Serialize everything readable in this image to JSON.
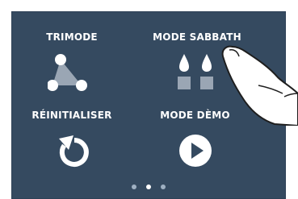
{
  "tiles": [
    {
      "label": "TRIMODE",
      "icon": "trimode-triangle-icon"
    },
    {
      "label": "MODE SABBATH",
      "icon": "sabbath-candles-icon"
    },
    {
      "label": "RÉINITIALISER",
      "icon": "reset-arrow-icon"
    },
    {
      "label": "MODE DÈMO",
      "icon": "play-icon"
    }
  ],
  "pagination": {
    "count": 3,
    "active_index": 1
  },
  "colors": {
    "background": "#354a60",
    "icon": "#ffffff",
    "triangle_fill": "#9aa6b4",
    "text": "#ffffff"
  }
}
